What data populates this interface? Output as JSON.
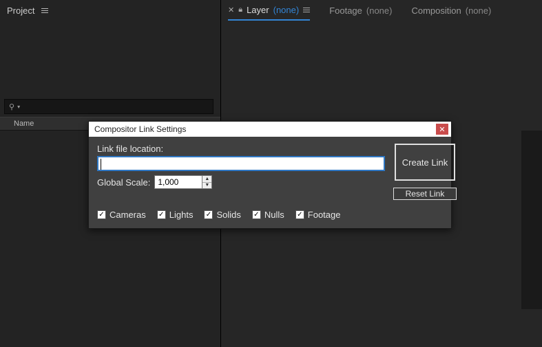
{
  "left_panel": {
    "title": "Project",
    "columns": {
      "name": "Name"
    }
  },
  "tabs": {
    "layer": {
      "label": "Layer",
      "value": "(none)"
    },
    "footage": {
      "label": "Footage",
      "value": "(none)"
    },
    "composition": {
      "label": "Composition",
      "value": "(none)"
    }
  },
  "dialog": {
    "title": "Compositor Link Settings",
    "link_label": "Link file location:",
    "link_value": "",
    "scale_label": "Global Scale:",
    "scale_value": "1,000",
    "create_link": "Create Link",
    "reset_link": "Reset Link",
    "checks": {
      "cameras": "Cameras",
      "lights": "Lights",
      "solids": "Solids",
      "nulls": "Nulls",
      "footage": "Footage"
    }
  }
}
